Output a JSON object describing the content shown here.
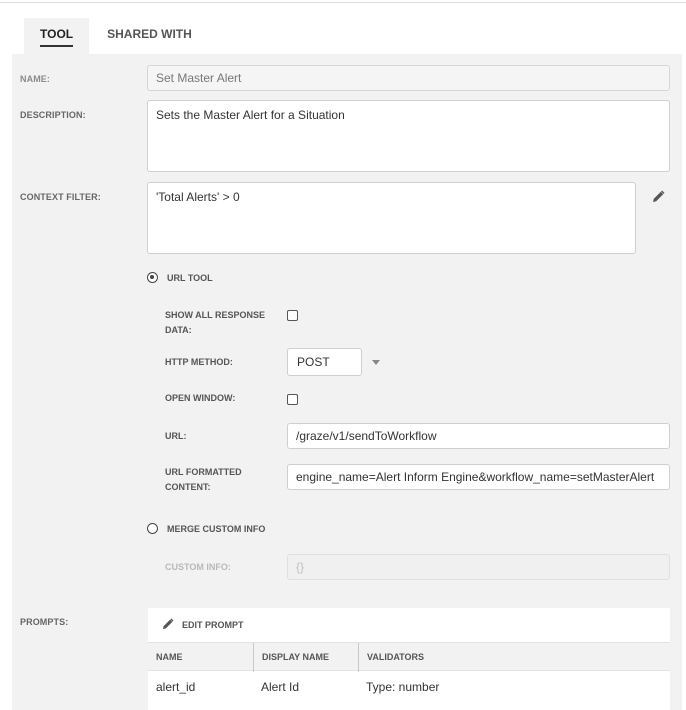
{
  "tabs": [
    {
      "label": "TOOL",
      "active": true
    },
    {
      "label": "SHARED WITH",
      "active": false
    }
  ],
  "form": {
    "name_label": "NAME:",
    "name_value": "Set Master Alert",
    "description_label": "DESCRIPTION:",
    "description_value": "Sets the Master Alert for a Situation",
    "context_filter_label": "CONTEXT FILTER:",
    "context_filter_value": "'Total Alerts' > 0",
    "url_tool_label": "URL TOOL",
    "show_all_label_1": "SHOW ALL RESPONSE",
    "show_all_label_2": "DATA:",
    "http_method_label": "HTTP METHOD:",
    "http_method_value": "POST",
    "open_window_label": "OPEN WINDOW:",
    "url_label": "URL:",
    "url_value": "/graze/v1/sendToWorkflow",
    "url_formatted_label_1": "URL FORMATTED",
    "url_formatted_label_2": "CONTENT:",
    "url_formatted_value": "engine_name=Alert Inform Engine&workflow_name=setMasterAlert",
    "merge_custom_label": "MERGE CUSTOM INFO",
    "custom_info_label": "CUSTOM INFO:",
    "custom_info_value": "{}",
    "prompts_label": "PROMPTS:"
  },
  "prompts": {
    "edit_label": "EDIT PROMPT",
    "columns": [
      "NAME",
      "DISPLAY NAME",
      "VALIDATORS"
    ],
    "rows": [
      {
        "name": "alert_id",
        "display_name": "Alert Id",
        "validators": "Type: number"
      }
    ]
  },
  "icons": {
    "edit": "pencil-icon",
    "caret": "chevron-down-icon"
  },
  "state": {
    "url_tool_selected": true,
    "merge_custom_selected": false,
    "show_all_checked": false,
    "open_window_checked": false
  }
}
